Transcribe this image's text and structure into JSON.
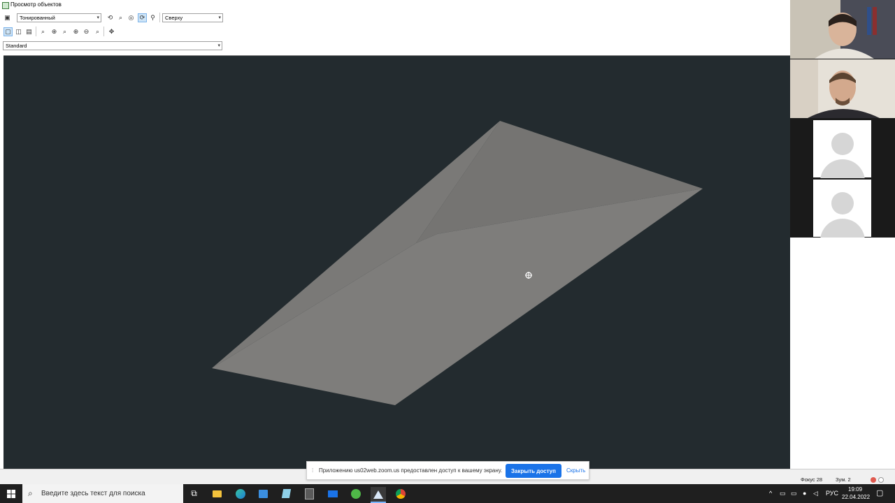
{
  "window": {
    "title": "Просмотр объектов",
    "shading_mode": "Тонированный",
    "view_direction": "Сверху",
    "visual_style": "Standard"
  },
  "toolbar1": {
    "icons": [
      "save-icon",
      "orbit-icon",
      "zoom-window-icon",
      "free-orbit-icon",
      "continuous-orbit-icon",
      "view-camera-icon"
    ]
  },
  "toolbar2": {
    "icons": [
      "view-single-icon",
      "view-cube-icon",
      "view-multi-icon",
      "zoom-realtime-icon",
      "zoom-in-icon",
      "zoom-window-icon",
      "zoom-extents-icon",
      "zoom-out-icon",
      "zoom-previous-icon",
      "pan-icon"
    ]
  },
  "status": {
    "focus": "Фокус 28",
    "zoom": "Зум. 2"
  },
  "zoom_share": {
    "message": "Приложению us02web.zoom.us предоставлен доступ к вашему экрану.",
    "stop_label": "Закрыть доступ",
    "hide_label": "Скрыть"
  },
  "taskbar": {
    "search_placeholder": "Введите здесь текст для поиска",
    "apps": [
      "task-view-icon",
      "file-explorer-icon",
      "edge-icon",
      "store-icon",
      "notes-icon",
      "calculator-icon",
      "mail-icon",
      "utorrent-icon",
      "autocad-icon",
      "chrome-icon"
    ],
    "language": "РУС",
    "time": "19:09",
    "date": "22.04.2022"
  },
  "colors": {
    "viewport_bg": "#232b2f",
    "surface": "#7b7a78",
    "accent": "#1a73e8"
  }
}
